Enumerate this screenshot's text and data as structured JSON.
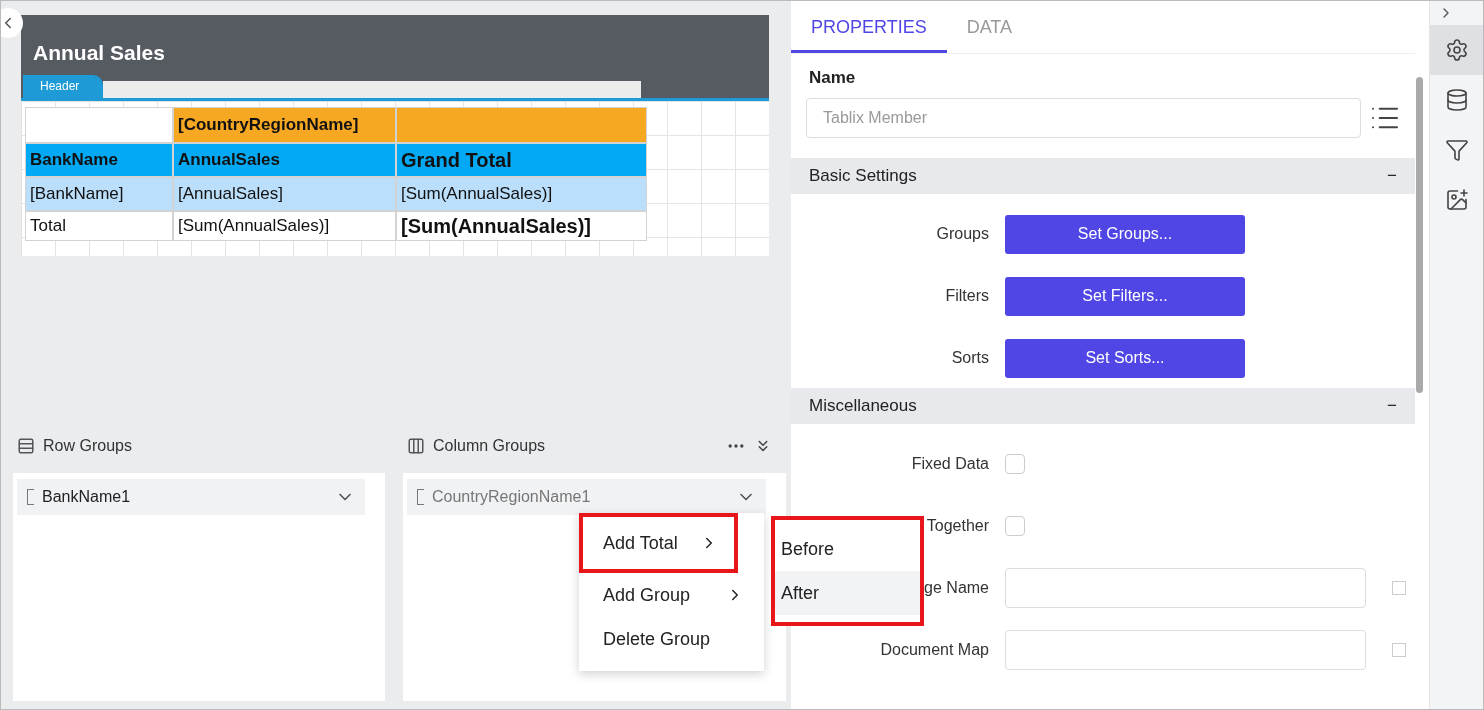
{
  "designer": {
    "report_title": "Annual Sales",
    "section_tab": "Header",
    "tablix": [
      {
        "kind": "group",
        "cells": [
          {},
          {
            "text": "[CountryRegionName]",
            "bold": true
          },
          {}
        ]
      },
      {
        "kind": "header",
        "cells": [
          {
            "text": "BankName",
            "bold": true
          },
          {
            "text": "AnnualSales",
            "bold": true
          },
          {
            "text": "Grand Total",
            "bold": true,
            "large": true
          }
        ]
      },
      {
        "kind": "detail",
        "cells": [
          {
            "text": "[BankName]"
          },
          {
            "text": "[AnnualSales]"
          },
          {
            "text": "[Sum(AnnualSales)]"
          }
        ]
      },
      {
        "kind": "total",
        "cells": [
          {
            "text": "Total"
          },
          {
            "text": "[Sum(AnnualSales)]"
          },
          {
            "text": "[Sum(AnnualSales)]",
            "bold": true,
            "large": true
          }
        ]
      }
    ]
  },
  "groups": {
    "row_groups": {
      "title": "Row Groups",
      "items": [
        {
          "label": "BankName1",
          "dimmed": false
        }
      ]
    },
    "column_groups": {
      "title": "Column Groups",
      "items": [
        {
          "label": "CountryRegionName1",
          "dimmed": true
        }
      ]
    }
  },
  "context_menu": {
    "items": [
      {
        "label": "Add Total",
        "submenu": true,
        "highlighted": true
      },
      {
        "label": "Add Group",
        "submenu": true,
        "highlighted": false
      },
      {
        "label": "Delete Group",
        "submenu": false,
        "highlighted": false
      }
    ],
    "submenu": {
      "highlighted": true,
      "items": [
        {
          "label": "Before",
          "hovered": false
        },
        {
          "label": "After",
          "hovered": true
        }
      ]
    }
  },
  "properties": {
    "tabs": [
      {
        "label": "PROPERTIES",
        "selected": true
      },
      {
        "label": "DATA",
        "selected": false
      }
    ],
    "name_label": "Name",
    "name_field": {
      "placeholder": "Tablix Member"
    },
    "sections": [
      {
        "title": "Basic Settings",
        "toggle": "−",
        "rows": [
          {
            "kind": "button",
            "label": "Groups",
            "button": "Set Groups..."
          },
          {
            "kind": "button",
            "label": "Filters",
            "button": "Set Filters..."
          },
          {
            "kind": "button",
            "label": "Sorts",
            "button": "Set Sorts..."
          }
        ]
      },
      {
        "title": "Miscellaneous",
        "toggle": "−",
        "rows": [
          {
            "kind": "checkbox",
            "label": "Fixed Data",
            "checked": false
          },
          {
            "kind": "checkbox",
            "label": "Together",
            "checked": false
          },
          {
            "kind": "text",
            "label": "ge Name",
            "checked": false
          },
          {
            "kind": "text",
            "label": "Document Map",
            "checked": false
          }
        ]
      }
    ]
  },
  "rail": [
    {
      "kind": "gear",
      "selected": true
    },
    {
      "kind": "database",
      "selected": false
    },
    {
      "kind": "filter",
      "selected": false
    },
    {
      "kind": "image",
      "selected": false
    }
  ]
}
